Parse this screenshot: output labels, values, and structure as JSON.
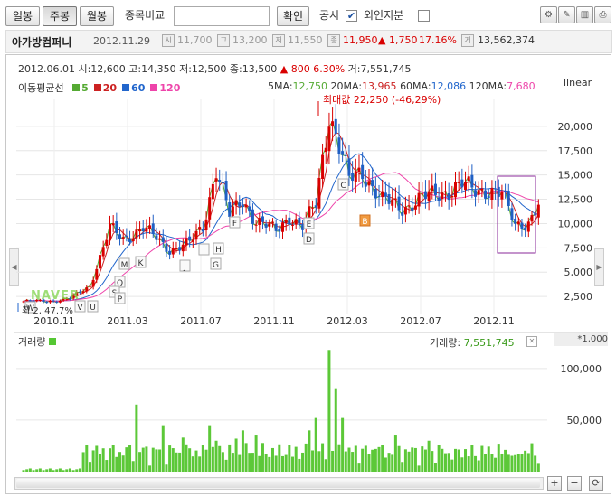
{
  "toolbar": {
    "tabs": [
      {
        "label": "일봉"
      },
      {
        "label": "주봉"
      },
      {
        "label": "월봉"
      }
    ],
    "compare_label": "종목비교",
    "compare_value": "",
    "confirm_label": "확인",
    "disclosure_label": "공시",
    "foreign_label": "외인지분",
    "icons": [
      "settings-icon",
      "pen-icon",
      "panel-icon",
      "print-icon"
    ]
  },
  "info": {
    "company": "아가방컴퍼니",
    "date": "2012.11.29",
    "open": "11,700",
    "high": "13,200",
    "low": "11,550",
    "close": "11,950",
    "change": "▲ 1,750",
    "change_pct": "17.16%",
    "volume": "13,562,374",
    "colors": {
      "up": "#d90000",
      "muted": "#999999"
    }
  },
  "chart": {
    "ohlc_date": "2012.06.01",
    "ohlc_text": "시:12,600 고:14,350 저:12,500 종:13,500",
    "ohlc_change": "▲ 800",
    "ohlc_pct": "6.30%",
    "ohlc_vol": "거:7,551,745",
    "ma_title": "이동평균선",
    "ma_legend": [
      {
        "label": "5",
        "color": "#55aa33"
      },
      {
        "label": "20",
        "color": "#cc2222"
      },
      {
        "label": "60",
        "color": "#2266cc"
      },
      {
        "label": "120",
        "color": "#ee44aa"
      }
    ],
    "ma_values": {
      "ma5_label": "5MA:",
      "ma5": "12,750",
      "ma20_label": "20MA:",
      "ma20": "13,965",
      "ma60_label": "60MA:",
      "ma60": "12,086",
      "ma120_label": "120MA:",
      "ma120": "7,680"
    },
    "scale_label": "linear",
    "max_annotation": "최대값 22,250 (-46,29%)",
    "min_annotation": "최 2,",
    "min_pct": "47.7%",
    "watermark": "NAVER",
    "volume_title": "거래량",
    "volume_readout_label": "거래량:",
    "volume_readout": "7,551,745",
    "volume_unit": "*1,000",
    "event_markers": [
      "W",
      "U",
      "V",
      "K",
      "M",
      "Q",
      "S",
      "P",
      "J",
      "I",
      "H",
      "G",
      "F",
      "E",
      "D",
      "C",
      "B"
    ]
  },
  "chart_data": [
    {
      "type": "candlestick",
      "x_ticks": [
        "2010.11",
        "2011.03",
        "2011.07",
        "2011.11",
        "2012.03",
        "2012.07",
        "2012.11"
      ],
      "y_ticks": [
        "2,500",
        "5,000",
        "7,500",
        "10,000",
        "12,500",
        "15,000",
        "17,500",
        "20,000"
      ],
      "ylim": [
        0,
        22500
      ],
      "max_value": 22250
    },
    {
      "type": "bar",
      "y_ticks": [
        "50,000",
        "100,000"
      ],
      "ylim": [
        0,
        120000
      ],
      "unit": "*1,000",
      "last_value": 7551745
    }
  ]
}
